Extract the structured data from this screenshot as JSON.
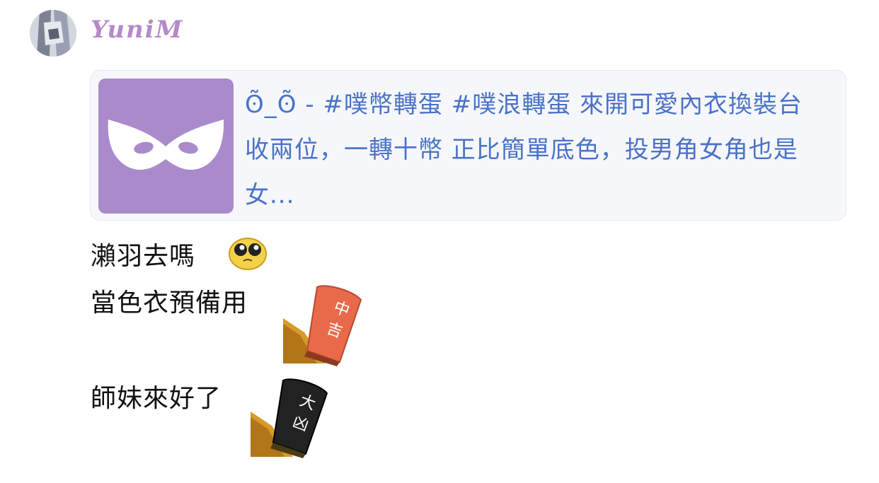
{
  "post": {
    "username": "YuniM",
    "avatar_icon": "avatar-icon"
  },
  "link_card": {
    "thumbnail_icon": "mask-icon",
    "thumbnail_color": "#a98bcb",
    "text": "ʘ̃_ʘ̃ - #噗幣轉蛋 #噗浪轉蛋 來開可愛內衣換裝台 收兩位，一轉十幣 正比簡單底色，投男角女角也是女...",
    "text_color": "#4a72c8"
  },
  "messages": [
    {
      "text": "瀨羽去嗎",
      "emoji": "pleading-face-icon"
    },
    {
      "text": "當色衣預備用",
      "emoji": "orange-stamp-icon",
      "emoji_text": "中吉"
    },
    {
      "text": "師妹來好了",
      "emoji": "black-stamp-icon",
      "emoji_text": "大凶"
    }
  ]
}
